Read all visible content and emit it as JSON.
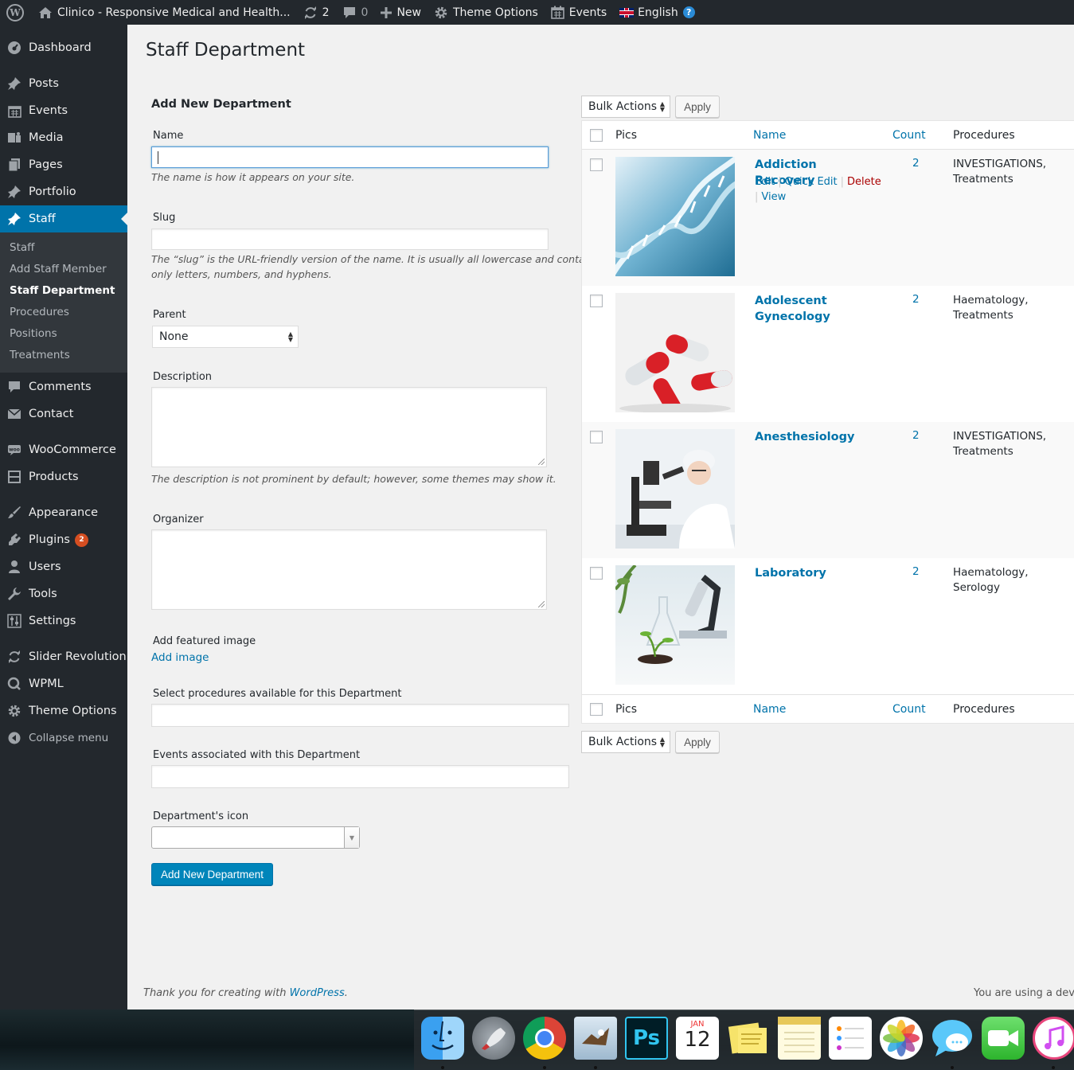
{
  "adminbar": {
    "site_title": "Clinico - Responsive Medical and Health...",
    "updates_count": "2",
    "comments_count": "0",
    "new_label": "New",
    "theme_options_label": "Theme Options",
    "events_label": "Events",
    "language_label": "English"
  },
  "sidebar": {
    "dashboard": "Dashboard",
    "posts": "Posts",
    "events": "Events",
    "media": "Media",
    "pages": "Pages",
    "portfolio": "Portfolio",
    "staff": "Staff",
    "submenu": {
      "staff": "Staff",
      "add_staff_member": "Add Staff Member",
      "staff_department": "Staff Department",
      "procedures": "Procedures",
      "positions": "Positions",
      "treatments": "Treatments"
    },
    "comments": "Comments",
    "contact": "Contact",
    "woocommerce": "WooCommerce",
    "products": "Products",
    "appearance": "Appearance",
    "plugins": "Plugins",
    "plugins_badge": "2",
    "users": "Users",
    "tools": "Tools",
    "settings": "Settings",
    "slider_revolution": "Slider Revolution",
    "wpml": "WPML",
    "theme_options": "Theme Options",
    "collapse": "Collapse menu"
  },
  "page": {
    "title": "Staff Department"
  },
  "form": {
    "heading": "Add New Department",
    "name_label": "Name",
    "name_value": "",
    "name_hint": "The name is how it appears on your site.",
    "slug_label": "Slug",
    "slug_value": "",
    "slug_hint_1": "The “slug” is the URL-friendly version of the name. It is usually all lowercase and contains",
    "slug_hint_2": "only letters, numbers, and hyphens.",
    "parent_label": "Parent",
    "parent_value": "None",
    "description_label": "Description",
    "description_hint": "The description is not prominent by default; however, some themes may show it.",
    "organizer_label": "Organizer",
    "featured_image_label": "Add featured image",
    "add_image_link": "Add image",
    "procedures_label": "Select procedures available for this Department",
    "events_label": "Events associated with this Department",
    "icon_label": "Department's icon",
    "submit_label": "Add New Department"
  },
  "list": {
    "bulk_actions": "Bulk Actions",
    "apply": "Apply",
    "columns": {
      "pics": "Pics",
      "name": "Name",
      "count": "Count",
      "procedures": "Procedures"
    },
    "row_actions": {
      "edit": "Edit",
      "quick_edit": "Quick Edit",
      "delete": "Delete",
      "view": "View"
    },
    "rows": [
      {
        "name": "Addiction Recovery",
        "count": "2",
        "procedures": "INVESTIGATIONS, Treatments",
        "image": "dna-image"
      },
      {
        "name": "Adolescent Gynecology",
        "count": "2",
        "procedures": "Haematology, Treatments",
        "image": "pills-image"
      },
      {
        "name": "Anesthesiology",
        "count": "2",
        "procedures": "INVESTIGATIONS, Treatments",
        "image": "lab-scientist-image"
      },
      {
        "name": "Laboratory",
        "count": "2",
        "procedures": "Haematology, Serology",
        "image": "microscope-plant-image"
      }
    ]
  },
  "footer": {
    "thanks_prefix": "Thank you for creating with ",
    "wordpress_link": "WordPress",
    "thanks_suffix": ".",
    "version_text": "You are using a deve"
  },
  "dock": {
    "calendar_month": "JAN",
    "calendar_day": "12",
    "photoshop_label": "Ps"
  },
  "colors": {
    "accent": "#0073aa",
    "sidebar": "#23282d",
    "submenu": "#32373c",
    "primary_button": "#0085ba",
    "badge": "#d54e21",
    "delete": "#aa0000"
  }
}
